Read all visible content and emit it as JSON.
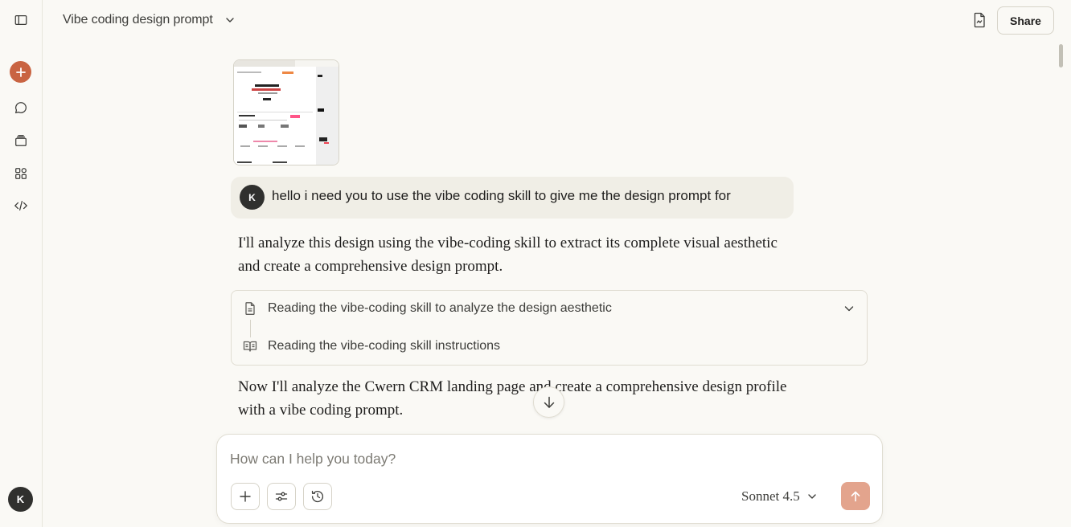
{
  "header": {
    "title": "Vibe coding design prompt",
    "share_label": "Share"
  },
  "sidebar": {
    "user_initial": "K",
    "items": [
      {
        "icon": "sidebar-toggle-icon"
      },
      {
        "icon": "plus-icon"
      },
      {
        "icon": "chat-bubble-icon"
      },
      {
        "icon": "projects-icon"
      },
      {
        "icon": "artifacts-icon"
      },
      {
        "icon": "code-icon"
      }
    ]
  },
  "conversation": {
    "user_initial": "K",
    "user_message": "hello i need you to use the vibe coding skill to give me the design prompt for",
    "assistant_intro_line1": "I'll analyze this design using the vibe-coding skill to extract its complete visual aesthetic",
    "assistant_intro_line2": "and create a comprehensive design prompt.",
    "tool_steps": [
      {
        "label": "Reading the vibe-coding skill to analyze the design aesthetic",
        "icon": "document-icon"
      },
      {
        "label": "Reading the vibe-coding skill instructions",
        "icon": "book-icon"
      }
    ],
    "assistant_followup_line1": "Now I'll analyze the Cwern CRM landing page and create a comprehensive design profile",
    "assistant_followup_line2": "with a vibe coding prompt."
  },
  "composer": {
    "placeholder": "How can I help you today?",
    "value": "",
    "model": "Sonnet 4.5"
  },
  "colors": {
    "background": "#faf9f5",
    "accent": "#c96442",
    "send_disabled": "#e3a48d",
    "user_bubble": "#f0eee6"
  }
}
